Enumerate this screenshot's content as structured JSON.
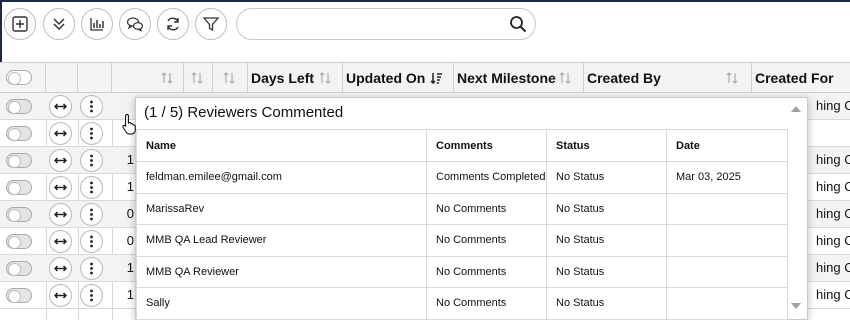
{
  "toolbar": {
    "buttons": [
      {
        "name": "add-icon"
      },
      {
        "name": "expand-all-icon"
      },
      {
        "name": "chart-icon"
      },
      {
        "name": "comments-icon"
      },
      {
        "name": "refresh-icon"
      },
      {
        "name": "filter-icon"
      }
    ],
    "search": {
      "value": "",
      "placeholder": "",
      "icon": "search-icon"
    }
  },
  "grid": {
    "headers": [
      "Days Left",
      "Updated On",
      "Next Milestone",
      "Created By",
      "Created For"
    ],
    "rows": [
      {
        "num": "",
        "right": "hing Co"
      },
      {
        "num": "",
        "right": ""
      },
      {
        "num": "1",
        "right": "hing Co"
      },
      {
        "num": "1",
        "right": "hing Co"
      },
      {
        "num": "0",
        "right": "hing Co"
      },
      {
        "num": "0",
        "right": "hing Co"
      },
      {
        "num": "1",
        "right": "hing Co"
      },
      {
        "num": "1",
        "right": "hing Co"
      }
    ]
  },
  "popup": {
    "title": "(1 / 5) Reviewers Commented",
    "columns": [
      "Name",
      "Comments",
      "Status",
      "Date"
    ],
    "rows": [
      {
        "name": "feldman.emilee@gmail.com",
        "comments": "Comments Completed",
        "status": "No Status",
        "date": "Mar 03, 2025"
      },
      {
        "name": "MarissaRev",
        "comments": "No Comments",
        "status": "No Status",
        "date": ""
      },
      {
        "name": "MMB QA Lead Reviewer",
        "comments": "No Comments",
        "status": "No Status",
        "date": ""
      },
      {
        "name": "MMB QA Reviewer",
        "comments": "No Comments",
        "status": "No Status",
        "date": ""
      },
      {
        "name": "Sally",
        "comments": "No Comments",
        "status": "No Status",
        "date": ""
      }
    ]
  }
}
